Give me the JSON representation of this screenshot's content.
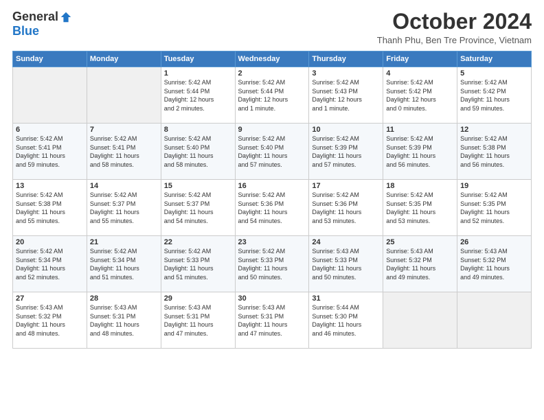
{
  "logo": {
    "general": "General",
    "blue": "Blue"
  },
  "header": {
    "month_title": "October 2024",
    "location": "Thanh Phu, Ben Tre Province, Vietnam"
  },
  "weekdays": [
    "Sunday",
    "Monday",
    "Tuesday",
    "Wednesday",
    "Thursday",
    "Friday",
    "Saturday"
  ],
  "weeks": [
    [
      {
        "day": "",
        "info": ""
      },
      {
        "day": "",
        "info": ""
      },
      {
        "day": "1",
        "info": "Sunrise: 5:42 AM\nSunset: 5:44 PM\nDaylight: 12 hours\nand 2 minutes."
      },
      {
        "day": "2",
        "info": "Sunrise: 5:42 AM\nSunset: 5:44 PM\nDaylight: 12 hours\nand 1 minute."
      },
      {
        "day": "3",
        "info": "Sunrise: 5:42 AM\nSunset: 5:43 PM\nDaylight: 12 hours\nand 1 minute."
      },
      {
        "day": "4",
        "info": "Sunrise: 5:42 AM\nSunset: 5:42 PM\nDaylight: 12 hours\nand 0 minutes."
      },
      {
        "day": "5",
        "info": "Sunrise: 5:42 AM\nSunset: 5:42 PM\nDaylight: 11 hours\nand 59 minutes."
      }
    ],
    [
      {
        "day": "6",
        "info": "Sunrise: 5:42 AM\nSunset: 5:41 PM\nDaylight: 11 hours\nand 59 minutes."
      },
      {
        "day": "7",
        "info": "Sunrise: 5:42 AM\nSunset: 5:41 PM\nDaylight: 11 hours\nand 58 minutes."
      },
      {
        "day": "8",
        "info": "Sunrise: 5:42 AM\nSunset: 5:40 PM\nDaylight: 11 hours\nand 58 minutes."
      },
      {
        "day": "9",
        "info": "Sunrise: 5:42 AM\nSunset: 5:40 PM\nDaylight: 11 hours\nand 57 minutes."
      },
      {
        "day": "10",
        "info": "Sunrise: 5:42 AM\nSunset: 5:39 PM\nDaylight: 11 hours\nand 57 minutes."
      },
      {
        "day": "11",
        "info": "Sunrise: 5:42 AM\nSunset: 5:39 PM\nDaylight: 11 hours\nand 56 minutes."
      },
      {
        "day": "12",
        "info": "Sunrise: 5:42 AM\nSunset: 5:38 PM\nDaylight: 11 hours\nand 56 minutes."
      }
    ],
    [
      {
        "day": "13",
        "info": "Sunrise: 5:42 AM\nSunset: 5:38 PM\nDaylight: 11 hours\nand 55 minutes."
      },
      {
        "day": "14",
        "info": "Sunrise: 5:42 AM\nSunset: 5:37 PM\nDaylight: 11 hours\nand 55 minutes."
      },
      {
        "day": "15",
        "info": "Sunrise: 5:42 AM\nSunset: 5:37 PM\nDaylight: 11 hours\nand 54 minutes."
      },
      {
        "day": "16",
        "info": "Sunrise: 5:42 AM\nSunset: 5:36 PM\nDaylight: 11 hours\nand 54 minutes."
      },
      {
        "day": "17",
        "info": "Sunrise: 5:42 AM\nSunset: 5:36 PM\nDaylight: 11 hours\nand 53 minutes."
      },
      {
        "day": "18",
        "info": "Sunrise: 5:42 AM\nSunset: 5:35 PM\nDaylight: 11 hours\nand 53 minutes."
      },
      {
        "day": "19",
        "info": "Sunrise: 5:42 AM\nSunset: 5:35 PM\nDaylight: 11 hours\nand 52 minutes."
      }
    ],
    [
      {
        "day": "20",
        "info": "Sunrise: 5:42 AM\nSunset: 5:34 PM\nDaylight: 11 hours\nand 52 minutes."
      },
      {
        "day": "21",
        "info": "Sunrise: 5:42 AM\nSunset: 5:34 PM\nDaylight: 11 hours\nand 51 minutes."
      },
      {
        "day": "22",
        "info": "Sunrise: 5:42 AM\nSunset: 5:33 PM\nDaylight: 11 hours\nand 51 minutes."
      },
      {
        "day": "23",
        "info": "Sunrise: 5:42 AM\nSunset: 5:33 PM\nDaylight: 11 hours\nand 50 minutes."
      },
      {
        "day": "24",
        "info": "Sunrise: 5:43 AM\nSunset: 5:33 PM\nDaylight: 11 hours\nand 50 minutes."
      },
      {
        "day": "25",
        "info": "Sunrise: 5:43 AM\nSunset: 5:32 PM\nDaylight: 11 hours\nand 49 minutes."
      },
      {
        "day": "26",
        "info": "Sunrise: 5:43 AM\nSunset: 5:32 PM\nDaylight: 11 hours\nand 49 minutes."
      }
    ],
    [
      {
        "day": "27",
        "info": "Sunrise: 5:43 AM\nSunset: 5:32 PM\nDaylight: 11 hours\nand 48 minutes."
      },
      {
        "day": "28",
        "info": "Sunrise: 5:43 AM\nSunset: 5:31 PM\nDaylight: 11 hours\nand 48 minutes."
      },
      {
        "day": "29",
        "info": "Sunrise: 5:43 AM\nSunset: 5:31 PM\nDaylight: 11 hours\nand 47 minutes."
      },
      {
        "day": "30",
        "info": "Sunrise: 5:43 AM\nSunset: 5:31 PM\nDaylight: 11 hours\nand 47 minutes."
      },
      {
        "day": "31",
        "info": "Sunrise: 5:44 AM\nSunset: 5:30 PM\nDaylight: 11 hours\nand 46 minutes."
      },
      {
        "day": "",
        "info": ""
      },
      {
        "day": "",
        "info": ""
      }
    ]
  ]
}
